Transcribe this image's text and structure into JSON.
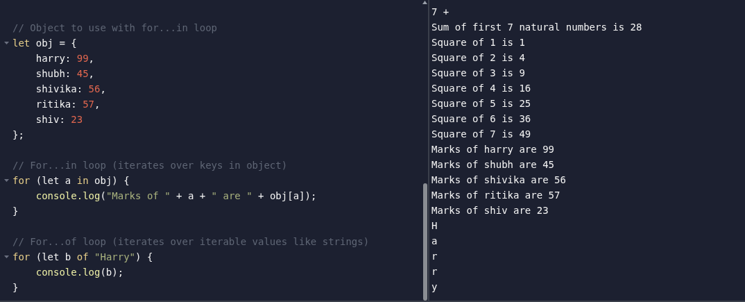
{
  "editor": {
    "lines": [
      {
        "fold": false
      },
      {
        "fold": false,
        "tokens": [
          {
            "kind": "comment",
            "text": "// Object to use with for...in loop"
          }
        ]
      },
      {
        "fold": true,
        "tokens": [
          {
            "kind": "keyword",
            "text": "let"
          },
          {
            "kind": "plain",
            "text": " obj = {"
          }
        ]
      },
      {
        "fold": false,
        "tokens": [
          {
            "kind": "plain",
            "text": "    harry: "
          },
          {
            "kind": "number",
            "text": "99"
          },
          {
            "kind": "plain",
            "text": ","
          }
        ]
      },
      {
        "fold": false,
        "tokens": [
          {
            "kind": "plain",
            "text": "    shubh: "
          },
          {
            "kind": "number",
            "text": "45"
          },
          {
            "kind": "plain",
            "text": ","
          }
        ]
      },
      {
        "fold": false,
        "tokens": [
          {
            "kind": "plain",
            "text": "    shivika: "
          },
          {
            "kind": "number",
            "text": "56"
          },
          {
            "kind": "plain",
            "text": ","
          }
        ]
      },
      {
        "fold": false,
        "tokens": [
          {
            "kind": "plain",
            "text": "    ritika: "
          },
          {
            "kind": "number",
            "text": "57"
          },
          {
            "kind": "plain",
            "text": ","
          }
        ]
      },
      {
        "fold": false,
        "tokens": [
          {
            "kind": "plain",
            "text": "    shiv: "
          },
          {
            "kind": "number",
            "text": "23"
          }
        ]
      },
      {
        "fold": false,
        "tokens": [
          {
            "kind": "plain",
            "text": "};"
          }
        ]
      },
      {
        "fold": false
      },
      {
        "fold": false,
        "tokens": [
          {
            "kind": "comment",
            "text": "// For...in loop (iterates over keys in object)"
          }
        ]
      },
      {
        "fold": true,
        "tokens": [
          {
            "kind": "keyword",
            "text": "for"
          },
          {
            "kind": "plain",
            "text": " (let a "
          },
          {
            "kind": "keyword",
            "text": "in"
          },
          {
            "kind": "plain",
            "text": " obj) {"
          }
        ]
      },
      {
        "fold": false,
        "tokens": [
          {
            "kind": "func",
            "text": "    console.log"
          },
          {
            "kind": "plain",
            "text": "("
          },
          {
            "kind": "string",
            "text": "\"Marks of \""
          },
          {
            "kind": "plain",
            "text": " + a + "
          },
          {
            "kind": "string",
            "text": "\" are \""
          },
          {
            "kind": "plain",
            "text": " + obj[a]);"
          }
        ]
      },
      {
        "fold": false,
        "tokens": [
          {
            "kind": "plain",
            "text": "}"
          }
        ]
      },
      {
        "fold": false
      },
      {
        "fold": false,
        "tokens": [
          {
            "kind": "comment",
            "text": "// For...of loop (iterates over iterable values like strings)"
          }
        ]
      },
      {
        "fold": true,
        "tokens": [
          {
            "kind": "keyword",
            "text": "for"
          },
          {
            "kind": "plain",
            "text": " (let b "
          },
          {
            "kind": "keyword",
            "text": "of"
          },
          {
            "kind": "string",
            "text": " \"Harry\""
          },
          {
            "kind": "plain",
            "text": ") {"
          }
        ]
      },
      {
        "fold": false,
        "tokens": [
          {
            "kind": "func",
            "text": "    console.log"
          },
          {
            "kind": "plain",
            "text": "(b);"
          }
        ]
      },
      {
        "fold": false,
        "tokens": [
          {
            "kind": "plain",
            "text": "}"
          }
        ]
      }
    ]
  },
  "console": {
    "lines": [
      "7 +",
      "Sum of first 7 natural numbers is 28",
      "Square of 1 is 1",
      "Square of 2 is 4",
      "Square of 3 is 9",
      "Square of 4 is 16",
      "Square of 5 is 25",
      "Square of 6 is 36",
      "Square of 7 is 49",
      "Marks of harry are 99",
      "Marks of shubh are 45",
      "Marks of shivika are 56",
      "Marks of ritika are 57",
      "Marks of shiv are 23",
      "H",
      "a",
      "r",
      "r",
      "y"
    ]
  }
}
